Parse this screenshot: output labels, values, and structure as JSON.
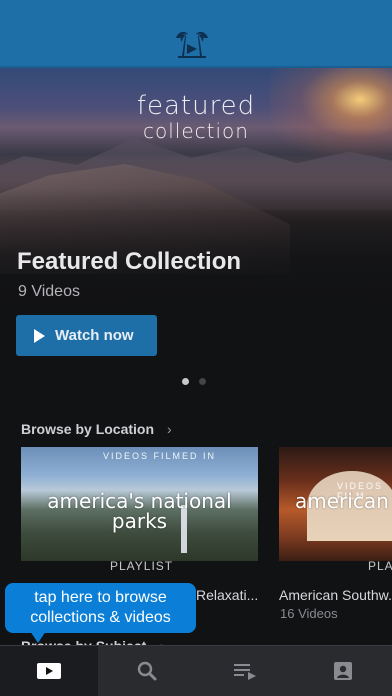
{
  "header": {
    "logo_icon": "palm-tree-logo-icon",
    "brand_color": "#1e6ea8"
  },
  "hero": {
    "stamp_line1": "featured",
    "stamp_line2": "collection",
    "title": "Featured Collection",
    "count": "9 Videos",
    "watch_label": "Watch now",
    "page_count": 2,
    "active_page": 1
  },
  "browse_location": {
    "title": "Browse by Location",
    "chevron": "›",
    "cards": [
      {
        "overline": "VIDEOS FILMED IN",
        "name": "america's national parks",
        "tag": "PLAYLIST",
        "caption": "Relaxati...",
        "count": ""
      },
      {
        "overline": "VIDEOS FILM",
        "name": "american",
        "tag": "PLA",
        "caption": "American Southw...",
        "count": "16 Videos"
      }
    ]
  },
  "browse_subject": {
    "title": "Browse by Subject",
    "chevron": "›"
  },
  "tooltip": {
    "line1": "tap here to browse",
    "line2": "collections & videos",
    "color": "#0b7fd8"
  },
  "tabbar": {
    "tabs": [
      {
        "icon": "play-icon",
        "active": true
      },
      {
        "icon": "search-icon",
        "active": false
      },
      {
        "icon": "playlist-icon",
        "active": false
      },
      {
        "icon": "account-icon",
        "active": false
      }
    ]
  }
}
